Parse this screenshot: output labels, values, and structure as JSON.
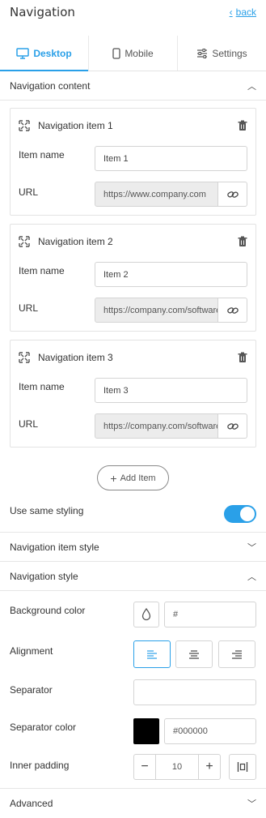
{
  "header": {
    "title": "Navigation",
    "back_label": "back"
  },
  "tabs": [
    {
      "label": "Desktop",
      "icon": "monitor-icon",
      "active": true
    },
    {
      "label": "Mobile",
      "icon": "phone-icon",
      "active": false
    },
    {
      "label": "Settings",
      "icon": "sliders-icon",
      "active": false
    }
  ],
  "navigation_content": {
    "label": "Navigation content",
    "items": [
      {
        "title": "Navigation item 1",
        "item_name_label": "Item name",
        "item_name_value": "Item 1",
        "url_label": "URL",
        "url_value": "https://www.company.com"
      },
      {
        "title": "Navigation item 2",
        "item_name_label": "Item name",
        "item_name_value": "Item 2",
        "url_label": "URL",
        "url_value": "https://company.com/software"
      },
      {
        "title": "Navigation item 3",
        "item_name_label": "Item name",
        "item_name_value": "Item 3",
        "url_label": "URL",
        "url_value": "https://company.com/software"
      }
    ],
    "add_item_label": "Add Item"
  },
  "use_same_styling": {
    "label": "Use same styling",
    "enabled": true
  },
  "navigation_item_style": {
    "label": "Navigation item style"
  },
  "navigation_style": {
    "label": "Navigation style",
    "background_color_label": "Background color",
    "background_color_value": "#",
    "alignment_label": "Alignment",
    "alignment_selected": "left",
    "separator_label": "Separator",
    "separator_value": "",
    "separator_color_label": "Separator color",
    "separator_color_value": "#000000",
    "inner_padding_label": "Inner padding",
    "inner_padding_value": "10"
  },
  "advanced": {
    "label": "Advanced"
  },
  "colors": {
    "accent": "#2aa0e8",
    "swatch": "#000000"
  }
}
